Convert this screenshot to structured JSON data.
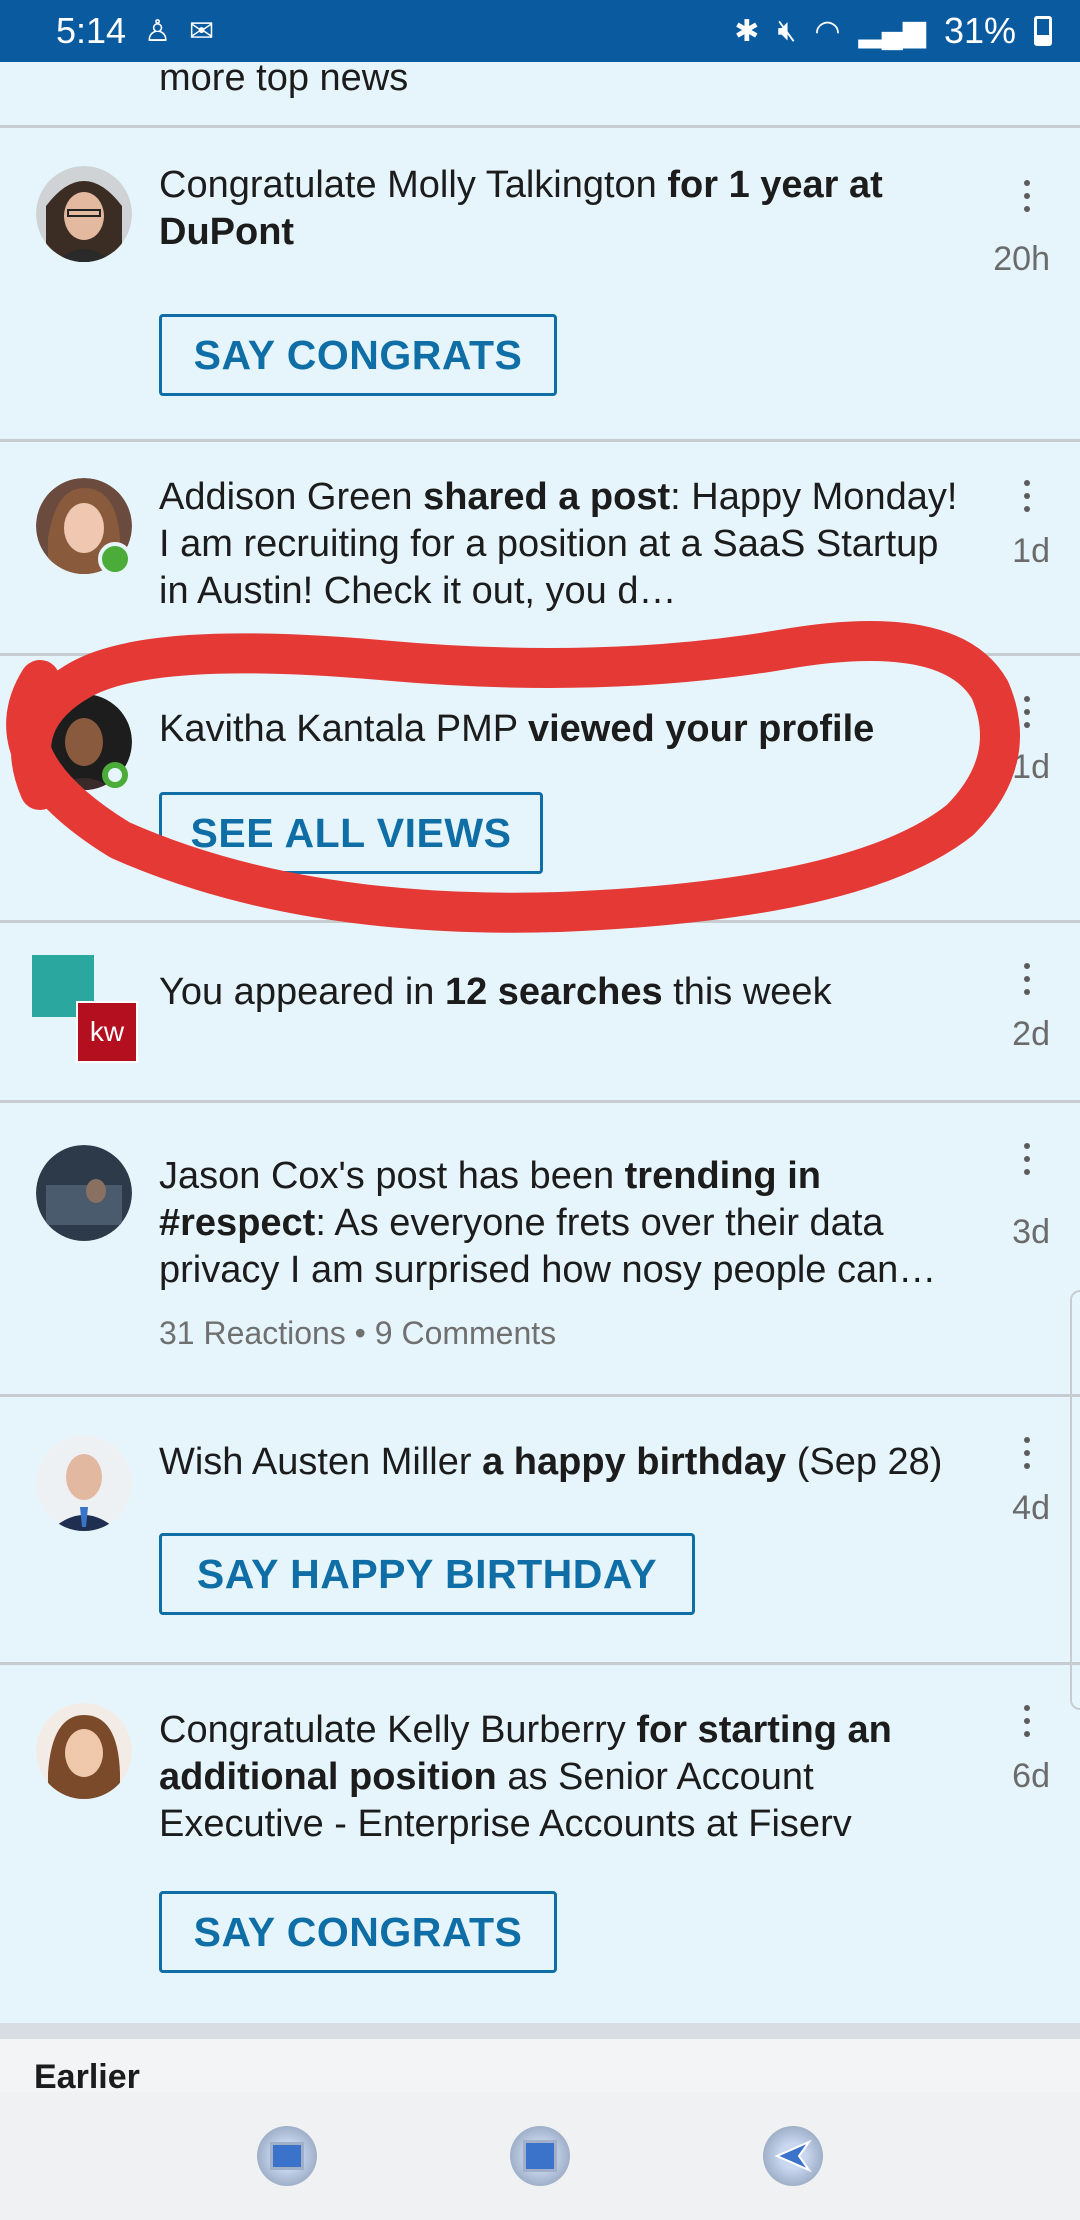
{
  "status_bar": {
    "time": "5:14",
    "battery": "31%"
  },
  "feed": {
    "top_cut_text": "more top news",
    "items": [
      {
        "text_pre": "Congratulate Molly Talkington ",
        "text_bold": "for 1 year at DuPont",
        "time": "20h",
        "button": "SAY CONGRATS"
      },
      {
        "text_pre": "Addison Green ",
        "text_bold": "shared a post",
        "text_post": ": Happy Monday! I am recruiting for a position at a SaaS Startup in Austin! Check it out, you d…",
        "time": "1d"
      },
      {
        "text_pre": "Kavitha Kantala PMP ",
        "text_bold": "viewed your profile",
        "time": "1d",
        "button": "SEE ALL VIEWS"
      },
      {
        "text_pre": "You appeared in ",
        "text_bold": "12 searches",
        "text_post": " this week",
        "time": "2d",
        "logo_text": "kw"
      },
      {
        "text_pre": "Jason Cox's post has been ",
        "text_bold": "trending in #respect",
        "text_post": ": As everyone frets over their data privacy I am surprised how nosy people can…",
        "meta": "31 Reactions • 9 Comments",
        "time": "3d"
      },
      {
        "text_pre": "Wish Austen Miller ",
        "text_bold": "a happy birthday",
        "text_post": " (Sep 28)",
        "time": "4d",
        "button": "SAY HAPPY BIRTHDAY"
      },
      {
        "text_pre": "Congratulate Kelly Burberry ",
        "text_bold": "for starting an additional position",
        "text_post": " as Senior Account Executive - Enterprise Accounts at Fiserv",
        "time": "6d",
        "button": "SAY CONGRATS"
      }
    ],
    "earlier_label": "Earlier"
  },
  "colors": {
    "status_bar": "#0a5aa0",
    "background": "#e6f5fc",
    "accent": "#0f6ea5",
    "online": "#4cac3a",
    "annotation": "#e53935"
  },
  "icons": [
    "bluetooth-icon",
    "mute-icon",
    "wifi-icon",
    "signal-icon",
    "battery-icon",
    "more-options-icon",
    "recent-apps-icon",
    "home-icon",
    "back-icon"
  ]
}
